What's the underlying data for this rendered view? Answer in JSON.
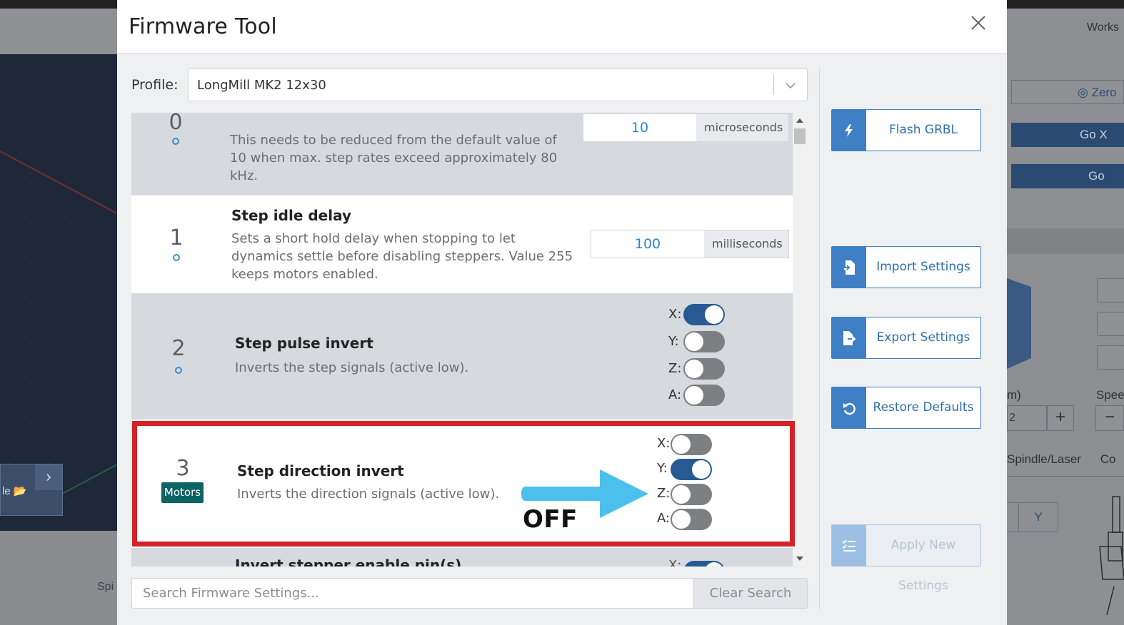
{
  "modal": {
    "title": "Firmware Tool",
    "profile_label": "Profile:",
    "profile_value": "LongMill MK2 12x30"
  },
  "settings": [
    {
      "number": "0",
      "title": "",
      "description": "This needs to be reduced from the default value of 10 when max. step rates exceed approximately 80 kHz.",
      "value": "10",
      "unit": "microseconds"
    },
    {
      "number": "1",
      "title": "Step idle delay",
      "description": "Sets a short hold delay when stopping to let dynamics settle before disabling steppers. Value 255 keeps motors enabled.",
      "value": "100",
      "unit": "milliseconds"
    },
    {
      "number": "2",
      "title": "Step pulse invert",
      "description": "Inverts the step signals (active low).",
      "axes": [
        {
          "label": "X:",
          "on": true
        },
        {
          "label": "Y:",
          "on": false
        },
        {
          "label": "Z:",
          "on": false
        },
        {
          "label": "A:",
          "on": false
        }
      ]
    },
    {
      "number": "3",
      "badge": "Motors",
      "title": "Step direction invert",
      "description": "Inverts the direction signals (active low).",
      "axes": [
        {
          "label": "X:",
          "on": false
        },
        {
          "label": "Y:",
          "on": true
        },
        {
          "label": "Z:",
          "on": false
        },
        {
          "label": "A:",
          "on": false
        }
      ]
    },
    {
      "number": "",
      "title": "Invert stepper enable pin(s)",
      "description": "",
      "axes": [
        {
          "label": "X:",
          "on": true
        }
      ]
    }
  ],
  "annotation": {
    "label": "OFF",
    "highlight_color": "#d42328",
    "arrow_color": "#4cc0ec"
  },
  "search": {
    "placeholder": "Search Firmware Settings...",
    "clear_label": "Clear Search"
  },
  "actions": {
    "flash": "Flash GRBL",
    "import": "Import Settings",
    "export": "Export Settings",
    "restore": "Restore Defaults",
    "apply": "Apply New Settings"
  },
  "background": {
    "workspace": "Works",
    "zero": "Zero",
    "go_x": "Go X",
    "go": "Go",
    "file": "le",
    "spindle_short": "Spi",
    "mm": "m)",
    "speed": "Spee",
    "input_val": "2",
    "tab_spindle": "Spindle/Laser",
    "tab_c": "Co",
    "y_button": "Y",
    "plus": "+",
    "minus": "−"
  },
  "colors": {
    "primary": "#3f7fc5",
    "toggle_on": "#275a92",
    "toggle_off": "#7e7f82",
    "badge": "#0e6363",
    "value_text": "#2f86c9"
  }
}
